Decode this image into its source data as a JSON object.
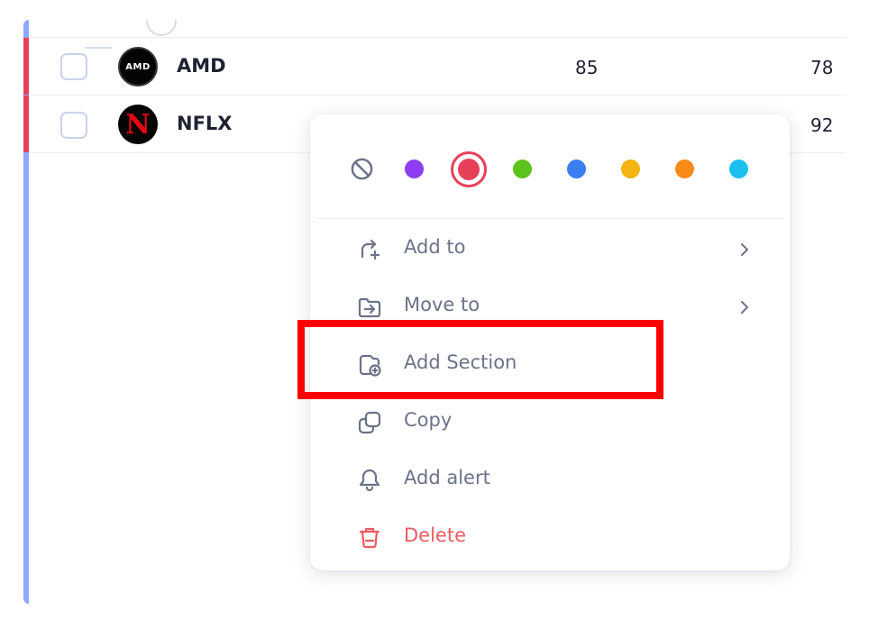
{
  "rows": [
    {
      "ticker": "AMD",
      "values": [
        "85",
        "78"
      ],
      "logo_icon": "amd-logo"
    },
    {
      "ticker": "NFLX",
      "values": [
        "",
        "92"
      ],
      "logo_icon": "netflix-logo"
    }
  ],
  "colors": {
    "options": [
      {
        "name": "no-color",
        "hex": ""
      },
      {
        "name": "purple",
        "hex": "#8e3df5"
      },
      {
        "name": "red",
        "hex": "#e8405a",
        "selected": true
      },
      {
        "name": "green",
        "hex": "#5cc21c"
      },
      {
        "name": "blue",
        "hex": "#3a7ef2"
      },
      {
        "name": "yellow",
        "hex": "#f5b40e"
      },
      {
        "name": "orange",
        "hex": "#f98a1a"
      },
      {
        "name": "cyan",
        "hex": "#1bc0ee"
      }
    ],
    "row_accent": "#e8405a",
    "panel_accent": "#8ea8ff"
  },
  "menu": {
    "items": [
      {
        "label": "Add to",
        "icon": "add-to-icon",
        "submenu": true
      },
      {
        "label": "Move to",
        "icon": "move-to-icon",
        "submenu": true
      },
      {
        "label": "Add Section",
        "icon": "add-section-icon",
        "submenu": false
      },
      {
        "label": "Copy",
        "icon": "copy-icon",
        "submenu": false
      },
      {
        "label": "Add alert",
        "icon": "bell-icon",
        "submenu": false
      },
      {
        "label": "Delete",
        "icon": "trash-icon",
        "submenu": false,
        "danger": true
      }
    ]
  },
  "logos": {
    "amd": "AMD",
    "nflx": "N"
  }
}
